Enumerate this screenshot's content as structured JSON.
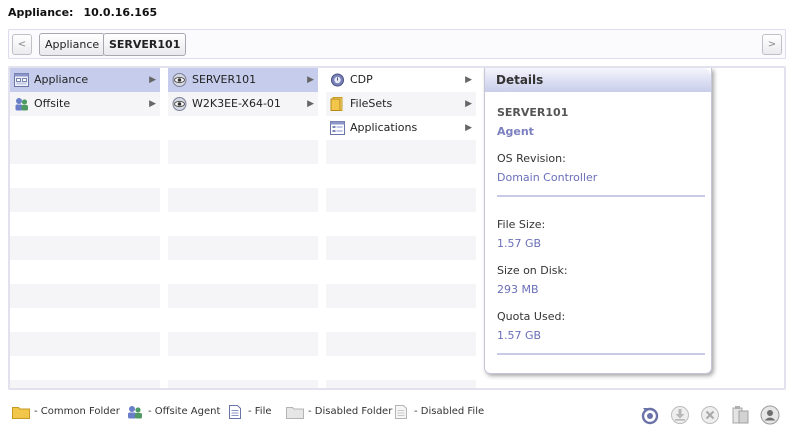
{
  "header": {
    "label": "Appliance:",
    "value": "10.0.16.165"
  },
  "crumbbar": {
    "prev": "<",
    "next": ">",
    "crumbs": [
      "Appliance",
      "SERVER101"
    ]
  },
  "columns": {
    "col0": [
      {
        "label": "Appliance",
        "icon": "appliance-icon",
        "selected": true
      },
      {
        "label": "Offsite",
        "icon": "offsite-agent-icon",
        "selected": false
      }
    ],
    "col1": [
      {
        "label": "SERVER101",
        "icon": "eye-icon",
        "selected": true
      },
      {
        "label": "W2K3EE-X64-01",
        "icon": "eye-icon",
        "selected": false
      }
    ],
    "col2": [
      {
        "label": "CDP",
        "icon": "cdp-icon",
        "selected": false
      },
      {
        "label": "FileSets",
        "icon": "folder-icon",
        "selected": false
      },
      {
        "label": "Applications",
        "icon": "applications-icon",
        "selected": false
      }
    ],
    "arrow": "▶"
  },
  "details": {
    "title": "Details",
    "name": "SERVER101",
    "type": "Agent",
    "os_label": "OS Revision:",
    "os_value": "Domain Controller",
    "file_size_label": "File Size:",
    "file_size_value": "1.57 GB",
    "disk_label": "Size on Disk:",
    "disk_value": "293 MB",
    "quota_label": "Quota Used:",
    "quota_value": "1.57 GB"
  },
  "legend": {
    "common_folder": "- Common Folder",
    "offsite_agent": "- Offsite Agent",
    "file": "- File",
    "disabled_folder": "- Disabled Folder",
    "disabled_file": "- Disabled File"
  },
  "toolbar": {
    "icons": [
      "refresh-icon",
      "download-icon",
      "close-icon",
      "clipboard-icon",
      "user-icon"
    ]
  },
  "colors": {
    "selection": "#c6cdec",
    "accent_text": "#6a6fb8",
    "folder": "#f2c64b"
  }
}
